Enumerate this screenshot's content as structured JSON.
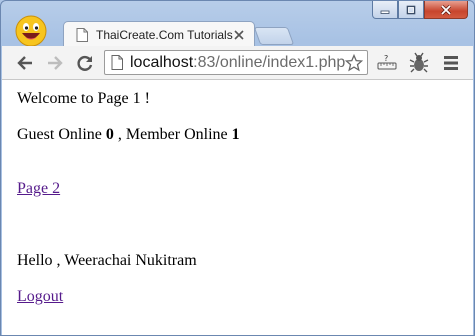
{
  "window": {
    "controls": {
      "minimize": "minimize-icon",
      "maximize": "maximize-icon",
      "close": "close-icon"
    }
  },
  "tab": {
    "title": "ThaiCreate.Com Tutorials"
  },
  "address_bar": {
    "host": "localhost",
    "rest": ":83/online/index1.php"
  },
  "page": {
    "welcome": "Welcome to Page 1 !",
    "guest_label": "Guest Online ",
    "guest_count": "0",
    "member_label": " , Member Online ",
    "member_count": "1",
    "page2_link": "Page 2",
    "hello": "Hello , Weerachai Nukitram",
    "logout_link": "Logout"
  },
  "colors": {
    "link_visited": "#551a8b",
    "frame": "#a8c2e4",
    "close_button": "#c7452d"
  }
}
